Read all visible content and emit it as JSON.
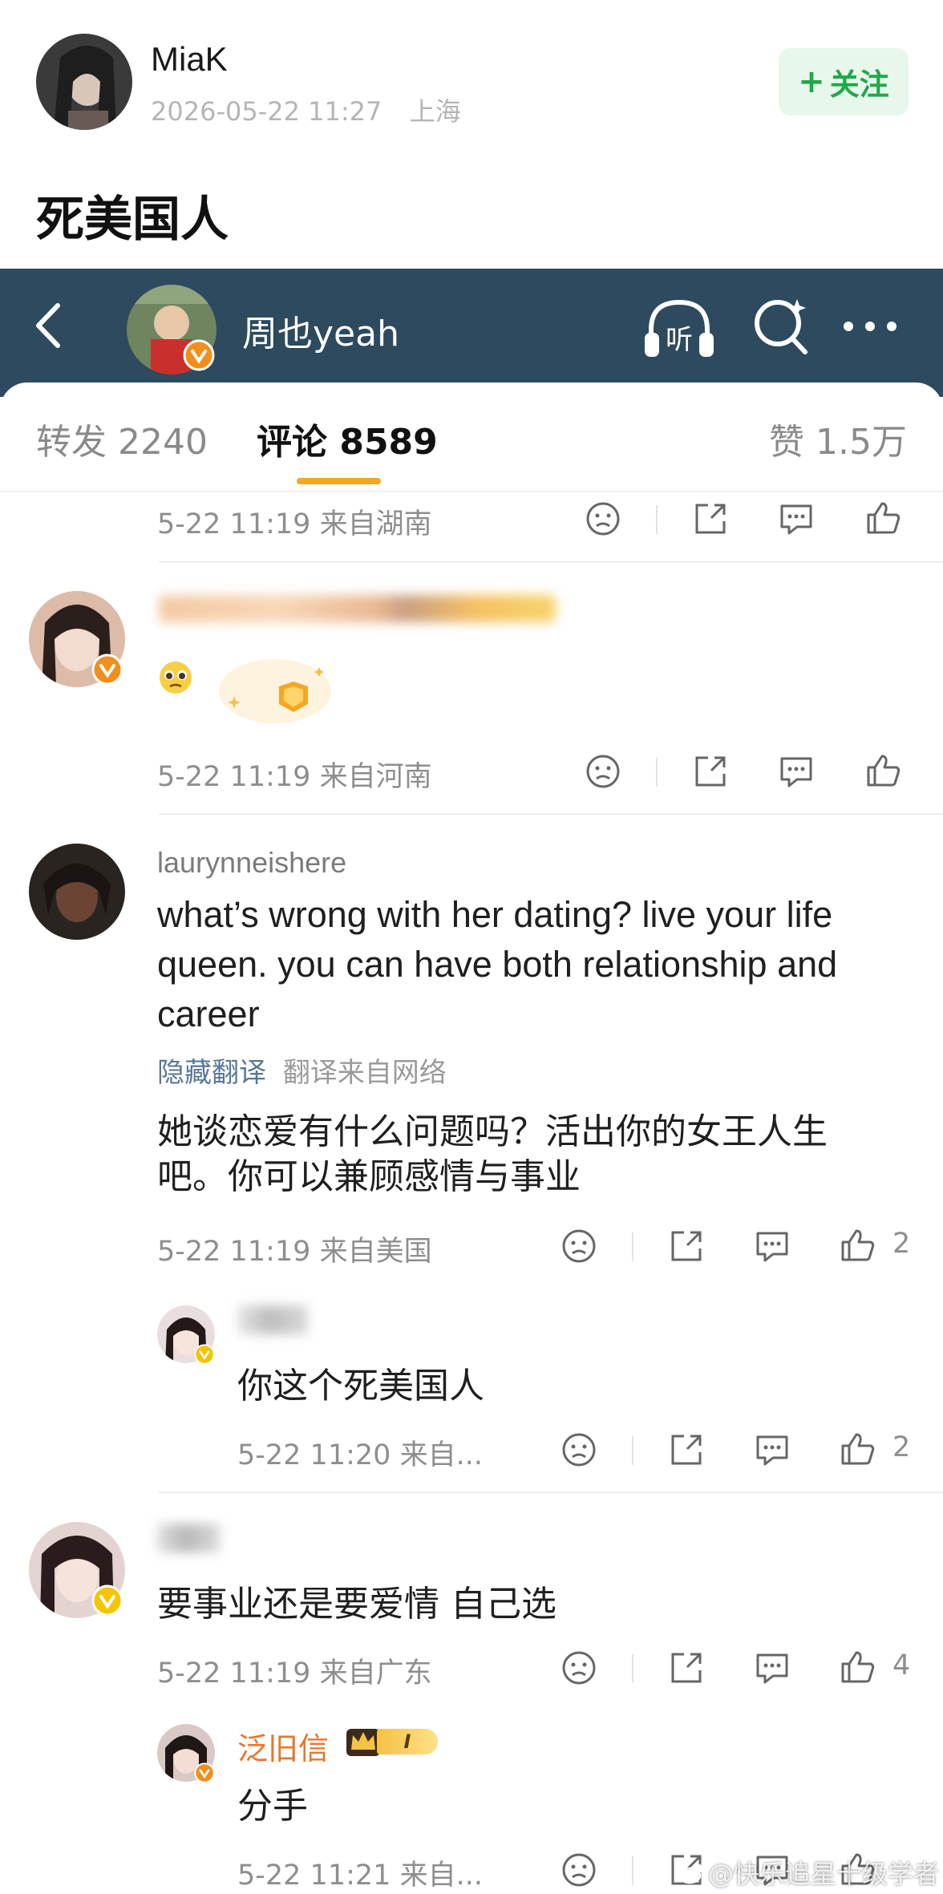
{
  "post": {
    "author": "MiaK",
    "timestamp": "2026-05-22 11:27",
    "location": "上海",
    "follow_label": "关注",
    "text": "死美国人",
    "author_avatar_icon": "avatar-girl-portrait"
  },
  "embedded": {
    "header": {
      "back_icon": "chevron-left-icon",
      "account_name": "周也yeah",
      "verified_icon": "verified-badge-icon",
      "listen_label": "听",
      "listen_icon": "headphones-icon",
      "search_icon": "search-icon",
      "more_icon": "more-dots-icon",
      "bg_color": "#2d4a5e"
    },
    "tabs": [
      {
        "label": "转发",
        "count": "2240"
      },
      {
        "label": "评论",
        "count": "8589",
        "active": true
      },
      {
        "label": "赞",
        "count": "1.5万"
      }
    ],
    "accent_color": "#f5a623",
    "comments": [
      {
        "id": "c0",
        "meta_time": "5-22 11:19",
        "meta_loc": "来自湖南",
        "like_count": ""
      },
      {
        "id": "c1",
        "username_redacted": true,
        "emoji_icon": "pleading-face-emoji",
        "decoration_icon": "gold-medal-sticker",
        "meta_time": "5-22 11:19",
        "meta_loc": "来自河南",
        "like_count": ""
      },
      {
        "id": "c2",
        "username": "laurynneishere",
        "text_lines": [
          "what’s wrong with her dating? live your life",
          "queen. you can have both relationship and",
          "career"
        ],
        "translate_hide": "隐藏翻译",
        "translate_source": "翻译来自网络",
        "translation_lines": [
          "她谈恋爱有什么问题吗？活出你的女王人生",
          "吧。你可以兼顾感情与事业"
        ],
        "meta_time": "5-22 11:19",
        "meta_loc": "来自美国",
        "like_count": "2",
        "reply": {
          "username_redacted": true,
          "text": "你这个死美国人",
          "meta_time": "5-22 11:20",
          "meta_loc": "来自...",
          "like_count": "2"
        }
      },
      {
        "id": "c3",
        "username_redacted": true,
        "text": "要事业还是要爱情 自己选",
        "meta_time": "5-22 11:19",
        "meta_loc": "来自广东",
        "like_count": "4",
        "reply": {
          "username": "泛旧信",
          "badge": "I",
          "text": "分手",
          "meta_time": "5-22 11:21",
          "meta_loc": "来自..."
        }
      }
    ],
    "action_icons": [
      "dislike-face-icon",
      "share-icon",
      "comment-icon",
      "thumbs-up-icon"
    ],
    "watermark": "@快乐追星十级学者"
  }
}
